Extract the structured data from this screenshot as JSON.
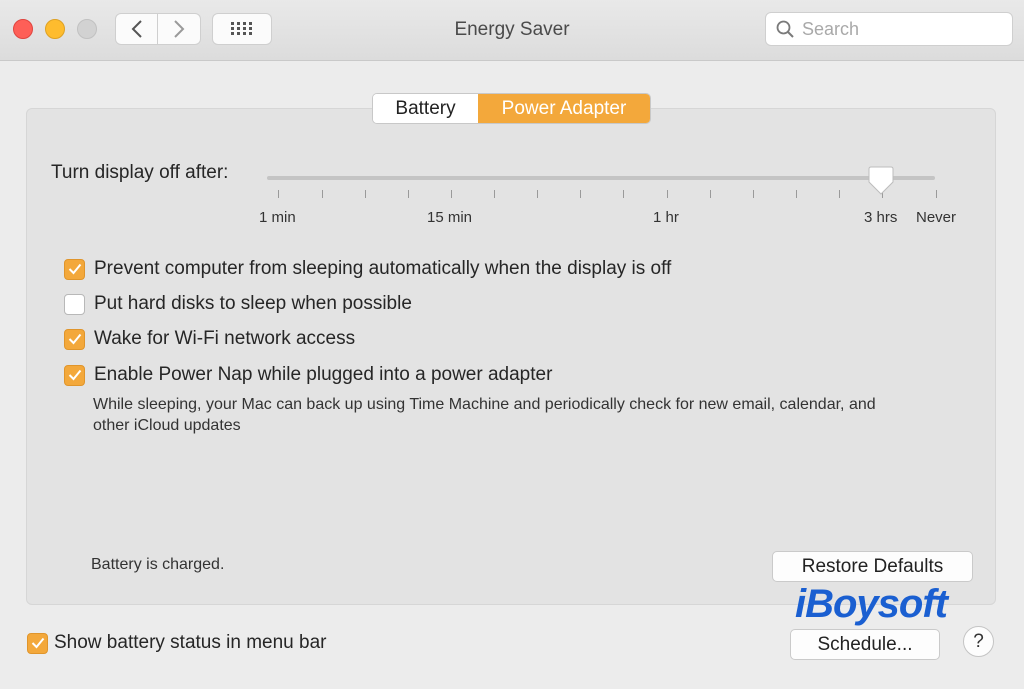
{
  "window": {
    "title": "Energy Saver",
    "search_placeholder": "Search"
  },
  "tabs": [
    {
      "label": "Battery",
      "selected": false
    },
    {
      "label": "Power Adapter",
      "selected": true
    }
  ],
  "slider": {
    "label": "Turn display off after:",
    "value": "3 hrs",
    "tick_labels": [
      "1 min",
      "15 min",
      "1 hr",
      "3 hrs",
      "Never"
    ]
  },
  "options": [
    {
      "label": "Prevent computer from sleeping automatically when the display is off",
      "checked": true
    },
    {
      "label": "Put hard disks to sleep when possible",
      "checked": false
    },
    {
      "label": "Wake for Wi-Fi network access",
      "checked": true
    },
    {
      "label": "Enable Power Nap while plugged into a power adapter",
      "checked": true
    }
  ],
  "power_nap_description": "While sleeping, your Mac can back up using Time Machine and periodically check for new email, calendar, and other iCloud updates",
  "status_text": "Battery is charged.",
  "buttons": {
    "restore": "Restore Defaults",
    "schedule": "Schedule...",
    "help": "?"
  },
  "footer_option": {
    "label": "Show battery status in menu bar",
    "checked": true
  },
  "watermark": "iBoysoft",
  "colors": {
    "accent": "#f3a83b",
    "watermark": "#1a5fd1"
  }
}
